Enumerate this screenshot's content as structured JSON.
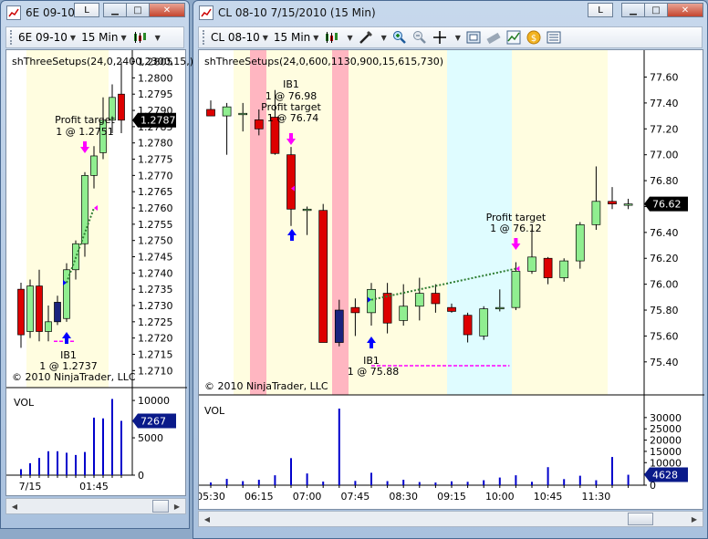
{
  "left_window": {
    "title": "6E 09-10",
    "l_label": "L",
    "instrument": "6E 09-10",
    "interval": "15 Min",
    "indicator": "shThreeSetups(24,0,2400,2300,15,)",
    "copyright": "© 2010 NinjaTrader, LLC",
    "vol_label": "VOL",
    "price_labels": [
      "1.2805",
      "1.2800",
      "1.2795",
      "1.2790",
      "1.2785",
      "1.2780",
      "1.2775",
      "1.2770",
      "1.2765",
      "1.2760",
      "1.2755",
      "1.2750",
      "1.2745",
      "1.2740",
      "1.2735",
      "1.2730",
      "1.2725",
      "1.2720",
      "1.2715",
      "1.2710"
    ],
    "last_price": "1.2787",
    "vol_axis": [
      "10000",
      "5000",
      "0"
    ],
    "vol_last": "7267",
    "time_labels": [
      "7/15",
      "01:45"
    ],
    "annotations": {
      "profit_target": "Profit target",
      "profit_target_value": "1 @ 1.2751",
      "ib_label": "IB1",
      "ib_value": "1 @ 1.2737"
    }
  },
  "right_window": {
    "title": "CL 08-10  7/15/2010 (15 Min)",
    "l_label": "L",
    "instrument": "CL 08-10",
    "interval": "15 Min",
    "indicator": "shThreeSetups(24,0,600,1130,900,15,615,730)",
    "copyright": "© 2010 NinjaTrader, LLC",
    "vol_label": "VOL",
    "price_labels": [
      "77.60",
      "77.40",
      "77.20",
      "77.00",
      "76.80",
      "76.60",
      "76.40",
      "76.20",
      "76.00",
      "75.80",
      "75.60",
      "75.40"
    ],
    "last_price": "76.62",
    "vol_axis": [
      "30000",
      "25000",
      "20000",
      "15000",
      "10000",
      "5000",
      "0"
    ],
    "vol_last": "4628",
    "time_labels": [
      "05:30",
      "06:15",
      "07:00",
      "07:45",
      "08:30",
      "09:15",
      "10:00",
      "10:45",
      "11:30"
    ],
    "annotations": {
      "ib1_top_label": "IB1",
      "ib1_top_value": "1 @ 76.98",
      "profit_target_1": "Profit target",
      "profit_target_1_value": "1 @ 76.74",
      "profit_target_2": "Profit target",
      "profit_target_2_value": "1 @ 76.12",
      "ib1_bottom_label": "IB1",
      "ib1_bottom_value": "1 @ 75.88"
    }
  },
  "colors": {
    "up_candle": "#90ee90",
    "down_candle": "#dd0000",
    "navy_candle": "#1a237e",
    "session_yellow": "#fffde0",
    "session_pink": "#ffb6c1",
    "session_cyan": "#dffcff",
    "volume_bar": "#0000cc",
    "arrow_up": "#0000ff",
    "arrow_down": "#ff00ff",
    "target_line": "#2e7d32"
  },
  "chart_data": [
    {
      "type": "candlestick",
      "instrument": "6E 09-10",
      "ylim": [
        1.2707,
        1.2806
      ],
      "candles": [
        {
          "o": 1.2735,
          "h": 1.2737,
          "l": 1.2717,
          "c": 1.2721
        },
        {
          "o": 1.2722,
          "h": 1.2738,
          "l": 1.272,
          "c": 1.2736
        },
        {
          "o": 1.2736,
          "h": 1.2741,
          "l": 1.2719,
          "c": 1.2722
        },
        {
          "o": 1.2722,
          "h": 1.273,
          "l": 1.2719,
          "c": 1.2725
        },
        {
          "o": 1.2731,
          "h": 1.2733,
          "l": 1.2724,
          "c": 1.2725
        },
        {
          "o": 1.2726,
          "h": 1.2743,
          "l": 1.2725,
          "c": 1.2741
        },
        {
          "o": 1.2741,
          "h": 1.275,
          "l": 1.2738,
          "c": 1.2749
        },
        {
          "o": 1.2749,
          "h": 1.2771,
          "l": 1.2745,
          "c": 1.277
        },
        {
          "o": 1.277,
          "h": 1.2779,
          "l": 1.2766,
          "c": 1.2776
        },
        {
          "o": 1.2777,
          "h": 1.2794,
          "l": 1.2775,
          "c": 1.2787
        },
        {
          "o": 1.2787,
          "h": 1.2798,
          "l": 1.2783,
          "c": 1.2794
        },
        {
          "o": 1.2795,
          "h": 1.2805,
          "l": 1.2783,
          "c": 1.2787
        }
      ],
      "volume": [
        800,
        1600,
        2300,
        3200,
        3200,
        3000,
        2700,
        3100,
        7700,
        7600,
        10200,
        7267
      ]
    },
    {
      "type": "candlestick",
      "instrument": "CL 08-10",
      "ylim": [
        75.3,
        77.66
      ],
      "candles": [
        {
          "o": 77.35,
          "h": 77.42,
          "l": 77.3,
          "c": 77.3
        },
        {
          "o": 77.3,
          "h": 77.4,
          "l": 77.0,
          "c": 77.37
        },
        {
          "o": 77.32,
          "h": 77.4,
          "l": 77.18,
          "c": 77.32
        },
        {
          "o": 77.27,
          "h": 77.35,
          "l": 77.15,
          "c": 77.2
        },
        {
          "o": 77.29,
          "h": 77.5,
          "l": 77.0,
          "c": 77.01
        },
        {
          "o": 77.0,
          "h": 77.06,
          "l": 76.45,
          "c": 76.58
        },
        {
          "o": 76.58,
          "h": 76.6,
          "l": 76.38,
          "c": 76.58
        },
        {
          "o": 76.57,
          "h": 76.62,
          "l": 75.55,
          "c": 75.55
        },
        {
          "o": 75.55,
          "h": 75.88,
          "l": 75.52,
          "c": 75.8
        },
        {
          "o": 75.82,
          "h": 75.89,
          "l": 75.6,
          "c": 75.78
        },
        {
          "o": 75.78,
          "h": 76.01,
          "l": 75.68,
          "c": 75.96
        },
        {
          "o": 75.93,
          "h": 76.01,
          "l": 75.62,
          "c": 75.7
        },
        {
          "o": 75.72,
          "h": 76.0,
          "l": 75.68,
          "c": 75.83
        },
        {
          "o": 75.83,
          "h": 76.05,
          "l": 75.72,
          "c": 75.93
        },
        {
          "o": 75.93,
          "h": 76.0,
          "l": 75.78,
          "c": 75.85
        },
        {
          "o": 75.82,
          "h": 75.85,
          "l": 75.78,
          "c": 75.79
        },
        {
          "o": 75.76,
          "h": 75.78,
          "l": 75.55,
          "c": 75.61
        },
        {
          "o": 75.6,
          "h": 75.83,
          "l": 75.57,
          "c": 75.81
        },
        {
          "o": 75.81,
          "h": 75.96,
          "l": 75.79,
          "c": 75.82
        },
        {
          "o": 75.82,
          "h": 76.17,
          "l": 75.8,
          "c": 76.1
        },
        {
          "o": 76.1,
          "h": 76.43,
          "l": 76.08,
          "c": 76.21
        },
        {
          "o": 76.2,
          "h": 76.21,
          "l": 76.0,
          "c": 76.05
        },
        {
          "o": 76.05,
          "h": 76.2,
          "l": 76.02,
          "c": 76.18
        },
        {
          "o": 76.18,
          "h": 76.48,
          "l": 76.12,
          "c": 76.46
        },
        {
          "o": 76.46,
          "h": 76.91,
          "l": 76.42,
          "c": 76.64
        },
        {
          "o": 76.64,
          "h": 76.75,
          "l": 76.58,
          "c": 76.62
        },
        {
          "o": 76.62,
          "h": 76.66,
          "l": 76.58,
          "c": 76.62
        }
      ],
      "volume": [
        1200,
        2800,
        1800,
        2400,
        4400,
        12000,
        5200,
        1600,
        34000,
        1900,
        5500,
        1800,
        2400,
        1400,
        1200,
        1700,
        1500,
        2200,
        3400,
        4400,
        1500,
        8000,
        2700,
        4200,
        2200,
        12500,
        4628
      ]
    }
  ]
}
